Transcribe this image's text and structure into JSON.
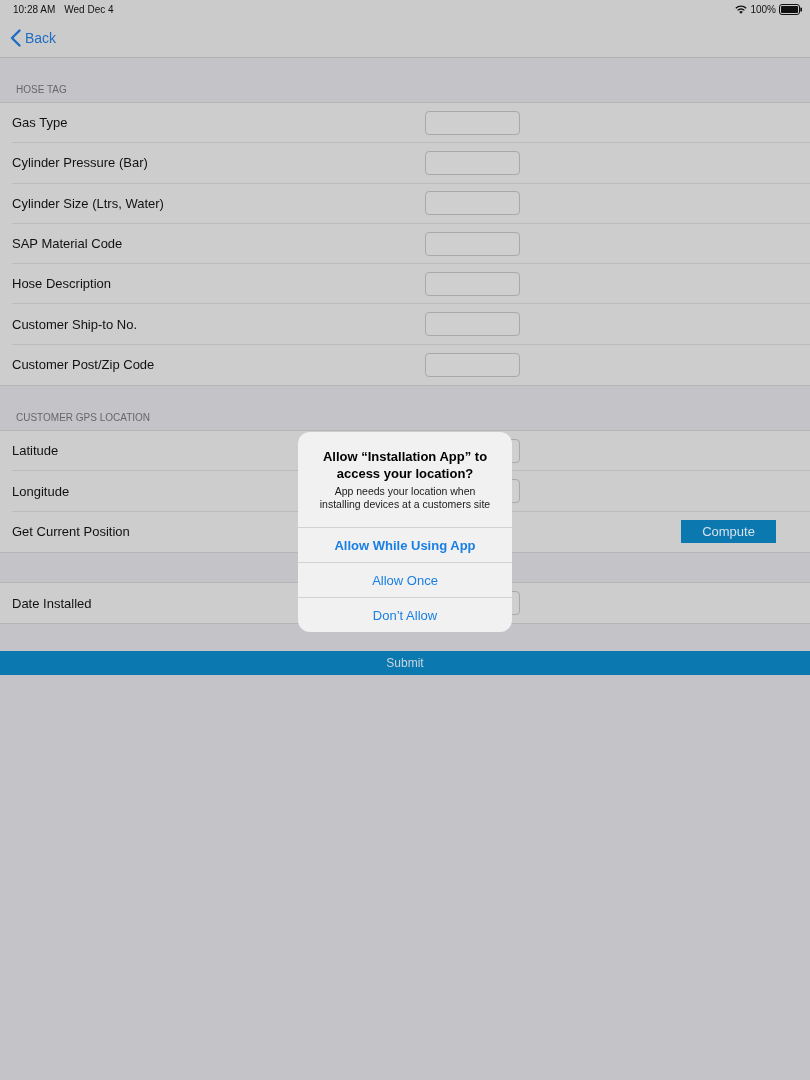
{
  "status_bar": {
    "time": "10:28 AM",
    "date": "Wed Dec 4",
    "battery": "100%"
  },
  "nav_bar": {
    "back": "Back"
  },
  "sections": [
    {
      "header": "HOSE TAG",
      "rows": [
        {
          "kind": "field",
          "label": "Gas Type"
        },
        {
          "kind": "field",
          "label": "Cylinder Pressure (Bar)"
        },
        {
          "kind": "field",
          "label": "Cylinder Size (Ltrs, Water)"
        },
        {
          "kind": "field",
          "label": "SAP Material Code"
        },
        {
          "kind": "field",
          "label": "Hose Description"
        },
        {
          "kind": "field",
          "label": "Customer Ship-to No."
        },
        {
          "kind": "field",
          "label": "Customer Post/Zip Code"
        }
      ]
    },
    {
      "header": "CUSTOMER GPS LOCATION",
      "rows": [
        {
          "kind": "field",
          "label": "Latitude"
        },
        {
          "kind": "field",
          "label": "Longitude"
        },
        {
          "kind": "button",
          "label": "Get Current Position",
          "button": "Compute"
        }
      ]
    },
    {
      "rows": [
        {
          "kind": "field",
          "label": "Date Installed"
        }
      ]
    }
  ],
  "submit_button": "Submit",
  "alert": {
    "title": "Allow “Installation App” to access your location?",
    "message": "App needs your location when installing devices at a customers site",
    "actions": [
      {
        "label": "Allow While Using App",
        "preferred": true
      },
      {
        "label": "Allow Once",
        "preferred": false
      },
      {
        "label": "Don’t Allow",
        "preferred": false
      }
    ]
  }
}
